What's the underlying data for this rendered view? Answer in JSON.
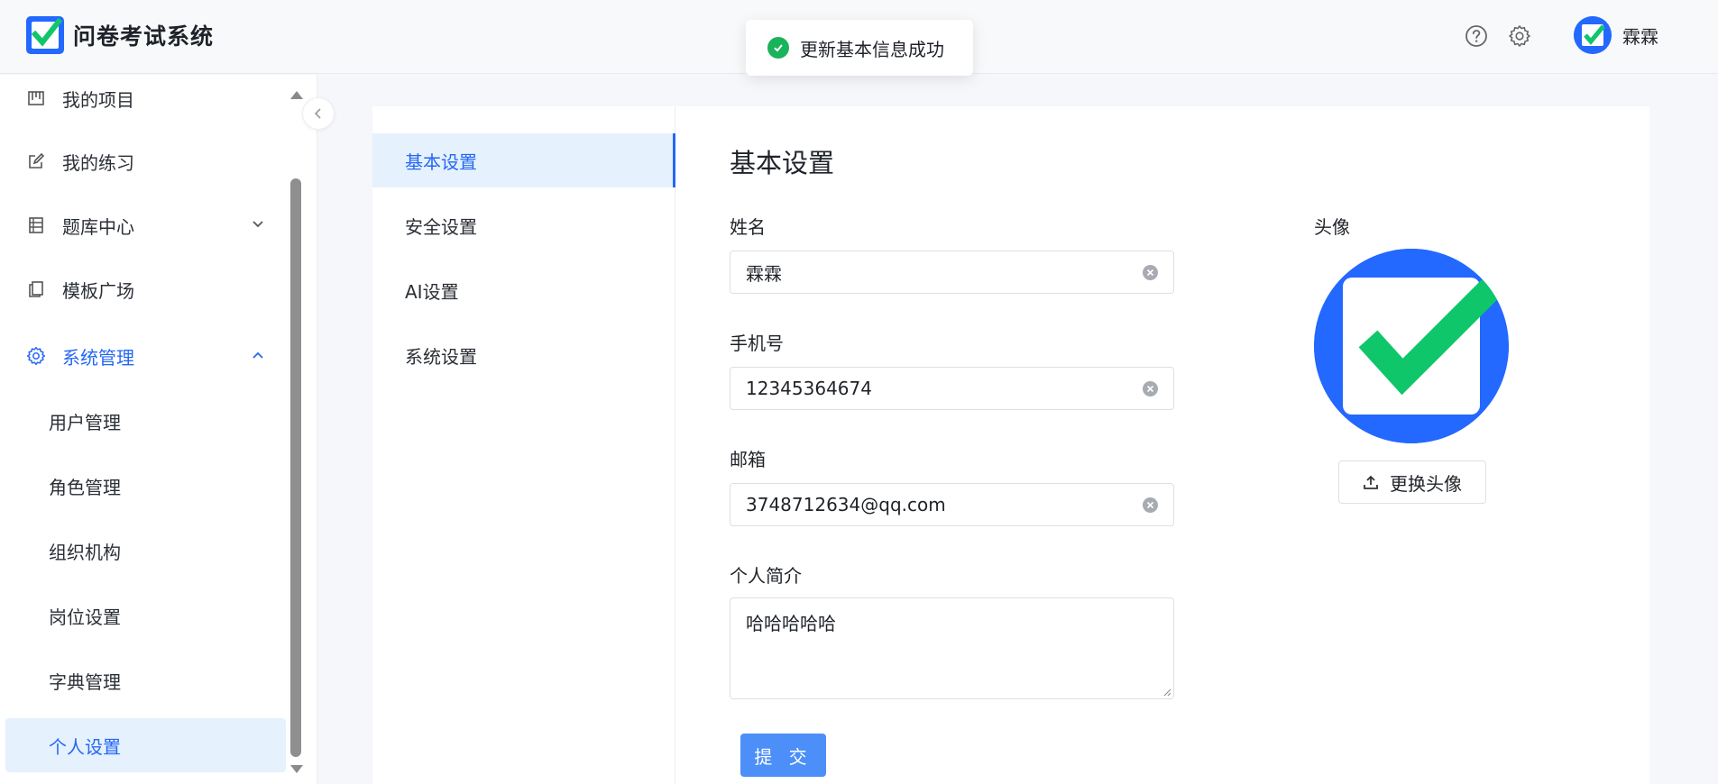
{
  "app": {
    "title": "问卷考试系统"
  },
  "toast": {
    "message": "更新基本信息成功"
  },
  "header": {
    "help_icon": "question-circle-icon",
    "settings_icon": "gear-icon",
    "user_name": "霖霖"
  },
  "sidebar": {
    "items": [
      {
        "label": "我的项目",
        "icon": "project-board-icon"
      },
      {
        "label": "我的练习",
        "icon": "edit-square-icon"
      },
      {
        "label": "题库中心",
        "icon": "question-bank-icon",
        "expandable": true
      },
      {
        "label": "模板广场",
        "icon": "template-copy-icon"
      },
      {
        "label": "系统管理",
        "icon": "gear-icon",
        "expanded": true
      }
    ],
    "sub_items": [
      "用户管理",
      "角色管理",
      "组织机构",
      "岗位设置",
      "字典管理",
      "个人设置"
    ],
    "selected": "个人设置"
  },
  "settings_tabs": [
    "基本设置",
    "安全设置",
    "AI设置",
    "系统设置"
  ],
  "active_tab": "基本设置",
  "form": {
    "title": "基本设置",
    "name_label": "姓名",
    "name_value": "霖霖",
    "phone_label": "手机号",
    "phone_value": "12345364674",
    "email_label": "邮箱",
    "email_value": "3748712634@qq.com",
    "bio_label": "个人简介",
    "bio_value": "哈哈哈哈哈",
    "submit_label": "提 交"
  },
  "avatar": {
    "label": "头像",
    "change_label": "更换头像"
  },
  "colors": {
    "primary": "#2468f2",
    "success": "#19b35b",
    "logo_blue": "#2368ff",
    "check_green": "#0fc66b"
  }
}
